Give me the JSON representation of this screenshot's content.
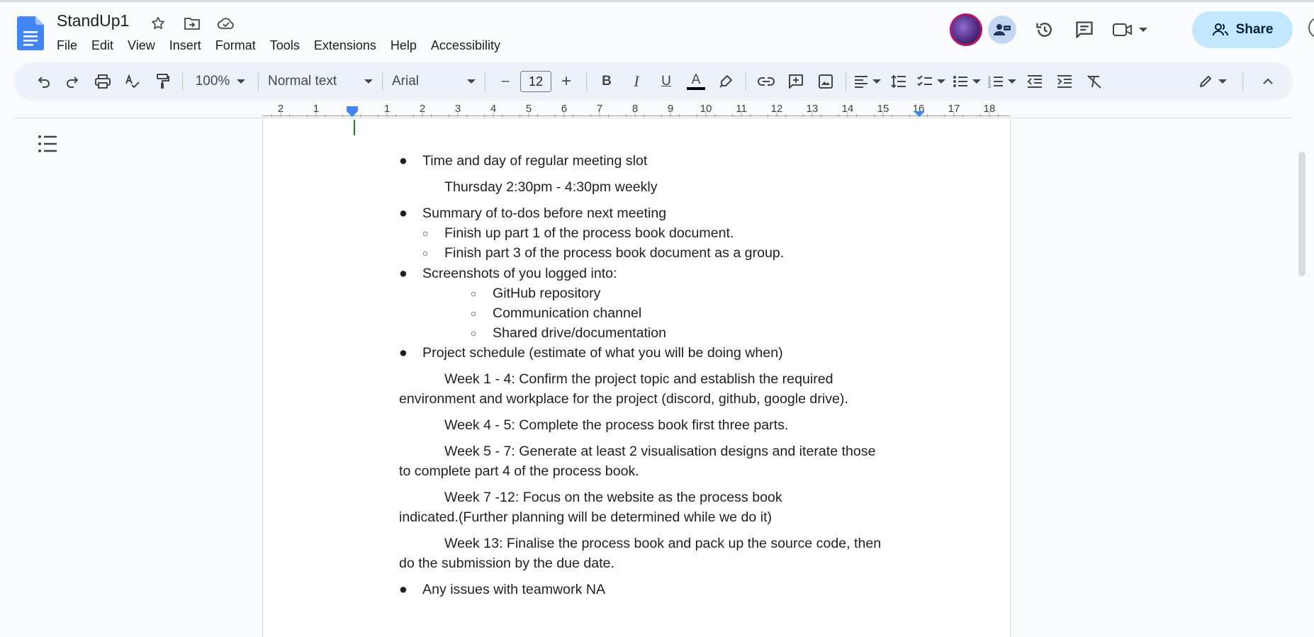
{
  "app": {
    "title": "StandUp1",
    "menus": [
      "File",
      "Edit",
      "View",
      "Insert",
      "Format",
      "Tools",
      "Extensions",
      "Help",
      "Accessibility"
    ],
    "share_label": "Share"
  },
  "toolbar": {
    "zoom": "100%",
    "style": "Normal text",
    "font": "Arial",
    "size": "12",
    "minus": "–",
    "plus": "+",
    "bold": "B",
    "italic": "I",
    "underline": "U",
    "textcolor": "A"
  },
  "ruler": {
    "labels": [
      "2",
      "1",
      "1",
      "2",
      "3",
      "4",
      "5",
      "6",
      "7",
      "8",
      "9",
      "10",
      "11",
      "12",
      "13",
      "14",
      "15",
      "16",
      "17",
      "18"
    ]
  },
  "doc": {
    "b1": "Time and day of regular meeting slot",
    "b1_detail": "Thursday 2:30pm - 4:30pm weekly",
    "b2": "Summary of to-dos before next meeting",
    "b2_s1": "Finish up part 1 of the process book document.",
    "b2_s2": "Finish part 3 of the process book document as a group.",
    "b3": "Screenshots of you logged into:",
    "b3_s1": "GitHub repository",
    "b3_s2": "Communication channel",
    "b3_s3": "Shared drive/documentation",
    "b4": "Project schedule (estimate of what you will be doing when)",
    "w1_a": "Week 1 - 4: Confirm the project topic and establish the required",
    "w1_b": "environment and workplace for the project (discord, github, google drive).",
    "w2": "Week 4 - 5: Complete the process book first three parts.",
    "w3_a": "Week 5 - 7: Generate at least 2 visualisation designs and iterate those",
    "w3_b": "to complete part 4 of the process book.",
    "w4_a": "Week 7 -12: Focus on the website as the process book",
    "w4_b": "indicated.(Further planning will be determined while we do it)",
    "w5_a": "Week 13: Finalise the process book and pack up the source code, then",
    "w5_b": "do the submission by the due date.",
    "b5": "Any issues with teamwork NA"
  },
  "colors": {
    "accent": "#1a73e8",
    "share_bg": "#c2e7ff",
    "toolbar_bg": "#edf2fa",
    "docs_blue": "#4285f4"
  },
  "icons": [
    "docs-logo-icon",
    "star-icon",
    "move-folder-icon",
    "cloud-saved-icon",
    "history-icon",
    "comment-icon",
    "meet-icon",
    "undo-icon",
    "redo-icon",
    "print-icon",
    "spellcheck-icon",
    "paint-format-icon",
    "highlight-icon",
    "link-icon",
    "add-comment-icon",
    "image-icon",
    "align-left-icon",
    "line-spacing-icon",
    "checklist-icon",
    "bullet-list-icon",
    "numbered-list-icon",
    "decrease-indent-icon",
    "increase-indent-icon",
    "clear-format-icon",
    "edit-mode-icon",
    "collapse-icon",
    "outline-icon"
  ]
}
